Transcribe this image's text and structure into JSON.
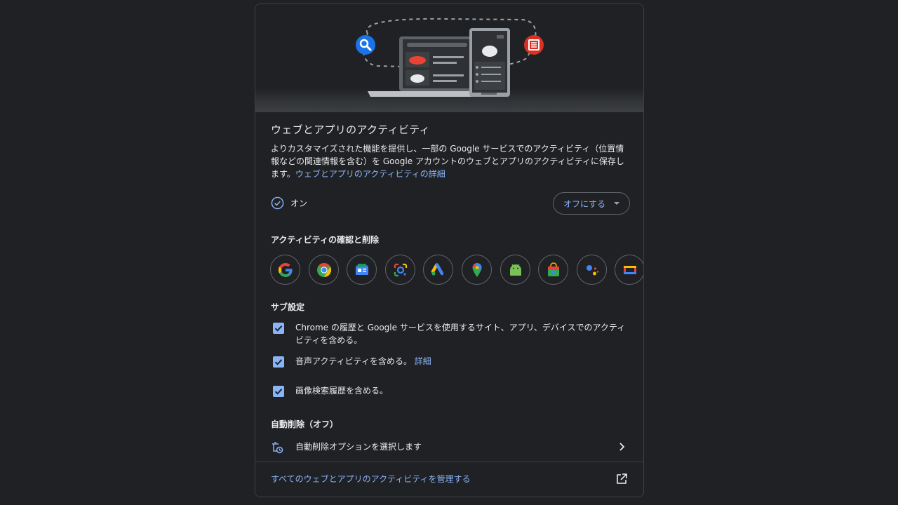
{
  "card": {
    "title": "ウェブとアプリのアクティビティ",
    "description": "よりカスタマイズされた機能を提供し、一部の Google サービスでのアクティビティ（位置情報などの関連情報を含む）を Google アカウントのウェブとアプリのアクティビティに保存します。",
    "details_link": "ウェブとアプリのアクティビティの詳細"
  },
  "status": {
    "label": "オン",
    "button_label": "オフにする"
  },
  "review": {
    "title": "アクティビティの確認と削除",
    "apps": [
      "google-icon",
      "chrome-icon",
      "news-icon",
      "lens-icon",
      "ads-icon",
      "maps-icon",
      "android-icon",
      "play-store-icon",
      "assistant-icon",
      "tv-icon",
      "translate-icon"
    ]
  },
  "sub_settings": {
    "title": "サブ設定",
    "items": [
      {
        "text": "Chrome の履歴と Google サービスを使用するサイト、アプリ、デバイスでのアクティビティを含める。",
        "checked": true
      },
      {
        "text": "音声アクティビティを含める。",
        "link": "詳細",
        "checked": true
      },
      {
        "text": "画像検索履歴を含める。",
        "checked": true
      }
    ]
  },
  "auto_delete": {
    "title": "自動削除（オフ）",
    "option_label": "自動削除オプションを選択します"
  },
  "footer": {
    "manage_link": "すべてのウェブとアプリのアクティビティを管理する"
  },
  "colors": {
    "background": "#202124",
    "accent": "#8ab4f8",
    "border": "#3c4043"
  }
}
